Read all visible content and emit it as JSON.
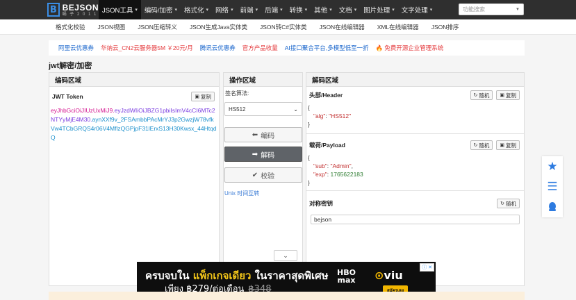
{
  "brand": {
    "name": "BEJSON",
    "sub": "蜗 子 2 0 1 1",
    "mark": "B"
  },
  "nav": {
    "items": [
      {
        "label": "JSON工具",
        "caret": "▾"
      },
      {
        "label": "编码/加密",
        "caret": "▾"
      },
      {
        "label": "格式化",
        "caret": "▾"
      },
      {
        "label": "网络",
        "caret": "▾"
      },
      {
        "label": "前端",
        "caret": "▾"
      },
      {
        "label": "后端",
        "caret": "▾"
      },
      {
        "label": "转换",
        "caret": "▾"
      },
      {
        "label": "其他",
        "caret": "▾"
      },
      {
        "label": "文档",
        "caret": "▾"
      },
      {
        "label": "图片处理",
        "caret": "▾"
      },
      {
        "label": "文字处理",
        "caret": "▾"
      }
    ],
    "search_placeholder": "功能搜索"
  },
  "subnav": [
    "格式化校验",
    "JSON视图",
    "JSON压缩转义",
    "JSON生成Java实体类",
    "JSON转C#实体类",
    "JSON在线编辑器",
    "XML在线编辑器",
    "JSON排序"
  ],
  "promo": [
    {
      "label": "阿里云优惠券",
      "color": "blue"
    },
    {
      "label": "华纳云_CN2云服务器5M ￥20元/月",
      "color": "red"
    },
    {
      "label": "腾讯云优惠券",
      "color": "blue"
    },
    {
      "label": "官方产品收量",
      "color": "red"
    },
    {
      "label": "AI接口聚合平台,多模型低至一折",
      "color": "blue"
    },
    {
      "label": "免费开源企业管理系统",
      "color": "red",
      "icon": "fire-icon"
    }
  ],
  "page_title": "jwt解密/加密",
  "encode": {
    "title": "编码区域",
    "token_label": "JWT Token",
    "copy_label": "复制",
    "jwt_header": "eyJhbGciOiJIUzUxMiJ9",
    "jwt_payload": "eyJzdWIiOiJBZG1pbiIsImV4cCI6MTc2NTYyMjE4M30",
    "jwt_signature": "aynXXf9v_2FSAmbbPAcMrYJ3p2GwzjW78vfkVw4TCbGRQS4r06V4MflzQGPjpF31lErxS13H30Kwsx_44HtqdQ",
    "dot": "."
  },
  "operate": {
    "title": "操作区域",
    "algo_label": "签名算法:",
    "algo_value": "HS512",
    "encode_btn": "编码",
    "decode_btn": "解码",
    "verify_btn": "校验",
    "unix_link": "Unix 时间互转"
  },
  "decode": {
    "title": "解码区域",
    "header_label": "头部/Header",
    "payload_label": "载荷/Payload",
    "secret_label": "对称密钥",
    "random_label": "随机",
    "copy_label": "复制",
    "header_open": "{",
    "header_close": "}",
    "header_key": "\"alg\"",
    "header_val": "\"HS512\"",
    "payload_open": "{",
    "payload_close": "}",
    "payload_key1": "\"sub\"",
    "payload_val1": "\"Admin\"",
    "payload_key2": "\"exp\"",
    "payload_val2": "1765622183",
    "colon": ": ",
    "comma": ",",
    "secret_value": "bejson"
  },
  "ad": {
    "line1_a": "ครบจบใน ",
    "line1_b": "แพ็กเกจเดียว",
    "line1_c": " ในราคาสุดพิเศษ",
    "line2_a": "เพียง ฿279/ต่อเดือน",
    "line2_b": "฿348",
    "hbo": "HBO",
    "max": "max",
    "viu": "viu",
    "cta": "สมัครเลย"
  },
  "colors": {
    "nav_bg": "#2f2f2f",
    "accent": "#2d7be0",
    "decode_btn": "#5f6368"
  }
}
